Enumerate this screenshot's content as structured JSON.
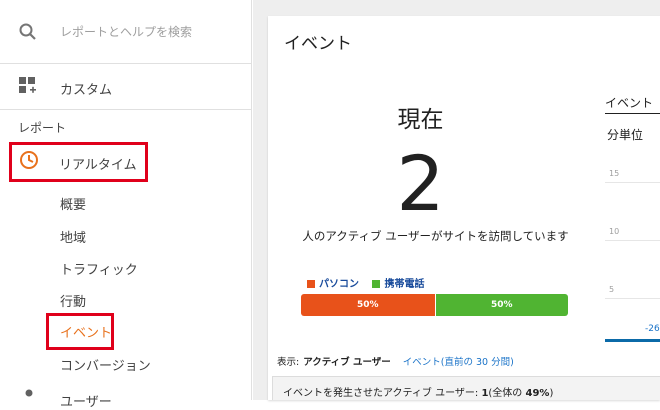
{
  "sidebar": {
    "search_placeholder": "レポートとヘルプを検索",
    "custom_label": "カスタム",
    "reports_label": "レポート",
    "realtime_label": "リアルタイム",
    "sub_items": [
      "概要",
      "地域",
      "トラフィック",
      "行動",
      "イベント",
      "コンバージョン"
    ],
    "selected_item": "イベント",
    "next_section_label": "ユーザー"
  },
  "card": {
    "title": "イベント",
    "now_label": "現在",
    "active_count": "2",
    "active_text": "人のアクティブ ユーザーがサイトを訪問しています",
    "legend": [
      {
        "label": "パソコン",
        "color": "#e8521a"
      },
      {
        "label": "携帯電話",
        "color": "#50b432"
      }
    ],
    "device_split": [
      {
        "label": "50%",
        "share": 0.5,
        "color": "#e8521a"
      },
      {
        "label": "50%",
        "share": 0.5,
        "color": "#50b432"
      }
    ],
    "view_prefix": "表示:",
    "view_active": "アクティブ ユーザー",
    "view_link": "イベント(直前の 30 分間)",
    "stat_text": "イベントを発生させたアクティブ ユーザー: ",
    "stat_count": "1",
    "stat_paren_open": "(全体の ",
    "stat_percent": "49%",
    "stat_paren_close": ")"
  },
  "right_panel": {
    "title": "イベント",
    "subtitle": "分単位",
    "y_ticks": [
      "15",
      "10",
      "5"
    ],
    "x_label": "-26"
  },
  "colors": {
    "accent_orange": "#e8711c",
    "highlight_red": "#e0001b",
    "link_blue": "#1a73c8"
  }
}
